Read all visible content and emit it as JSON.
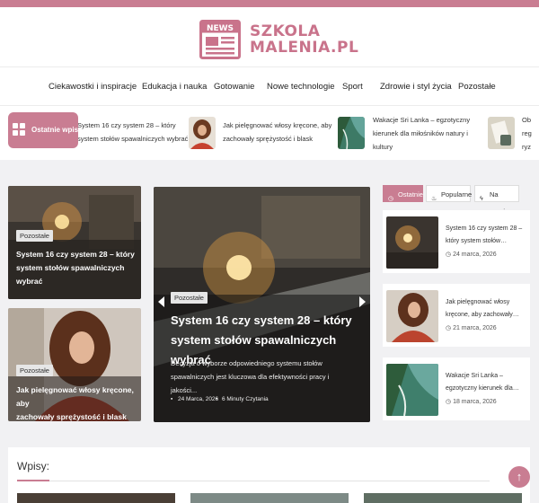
{
  "site": {
    "name_line1": "SZKOLA",
    "name_line2": "MALENIA.PL",
    "logo_label": "NEWS",
    "accent": "#c97d92"
  },
  "nav": {
    "items": [
      {
        "label": "Ciekawostki i inspiracje"
      },
      {
        "label": "Edukacja i nauka"
      },
      {
        "label": "Gotowanie"
      },
      {
        "label": "Nowe technologie"
      },
      {
        "label": "Sport"
      },
      {
        "label": "Zdrowie i styl życia"
      },
      {
        "label": "Pozostałe"
      }
    ]
  },
  "ticker": {
    "badge": "Ostatnie wpisy",
    "items": [
      {
        "line1": "System 16 czy system 28 – który",
        "line2": "system stołów spawalniczych wybrać"
      },
      {
        "line1": "Jak pielęgnować włosy kręcone, aby",
        "line2": "zachowały sprężystość i blask"
      },
      {
        "line1": "Wakacje Sri Lanka – egzotyczny",
        "line2": "kierunek dla miłośników natury i",
        "line3": "kultury"
      },
      {
        "line1": "Ob",
        "line2": "reg",
        "line3": "ryz"
      }
    ]
  },
  "left_cards": [
    {
      "badge": "Pozostałe",
      "line1": "System 16 czy system 28 – który",
      "line2": "system stołów spawalniczych",
      "line3": "wybrać"
    },
    {
      "badge": "Pozostałe",
      "line1": "Jak pielęgnować włosy kręcone, aby",
      "line2": "zachowały sprężystość i blask"
    }
  ],
  "hero": {
    "badge": "Pozostałe",
    "title_line1": "System 16 czy system 28 – który",
    "title_line2": "system stołów spawalniczych wybrać",
    "desc_line1": "Decyzja o wyborze odpowiedniego systemu stołów",
    "desc_line2": "spawalniczych jest kluczowa dla efektywności pracy i jakości...",
    "date": "24 Marca, 2026",
    "read_time": "6 Minuty Czytania"
  },
  "tabs": [
    {
      "label": "Ostatnie",
      "icon": "clock-icon"
    },
    {
      "label": "Popularne",
      "icon": "flame-icon"
    },
    {
      "label": "Na czasie",
      "icon": "bolt-icon"
    }
  ],
  "side_posts": [
    {
      "line1": "System 16 czy system 28 –",
      "line2": "który system stołów…",
      "date": "24 marca, 2026"
    },
    {
      "line1": "Jak pielęgnować włosy",
      "line2": "kręcone, aby zachowały…",
      "date": "21 marca, 2026"
    },
    {
      "line1": "Wakacje Sri Lanka –",
      "line2": "egzotyczny kierunek dla…",
      "date": "18 marca, 2026"
    }
  ],
  "posts_section": {
    "title": "Wpisy:"
  },
  "back_to_top": "↑"
}
